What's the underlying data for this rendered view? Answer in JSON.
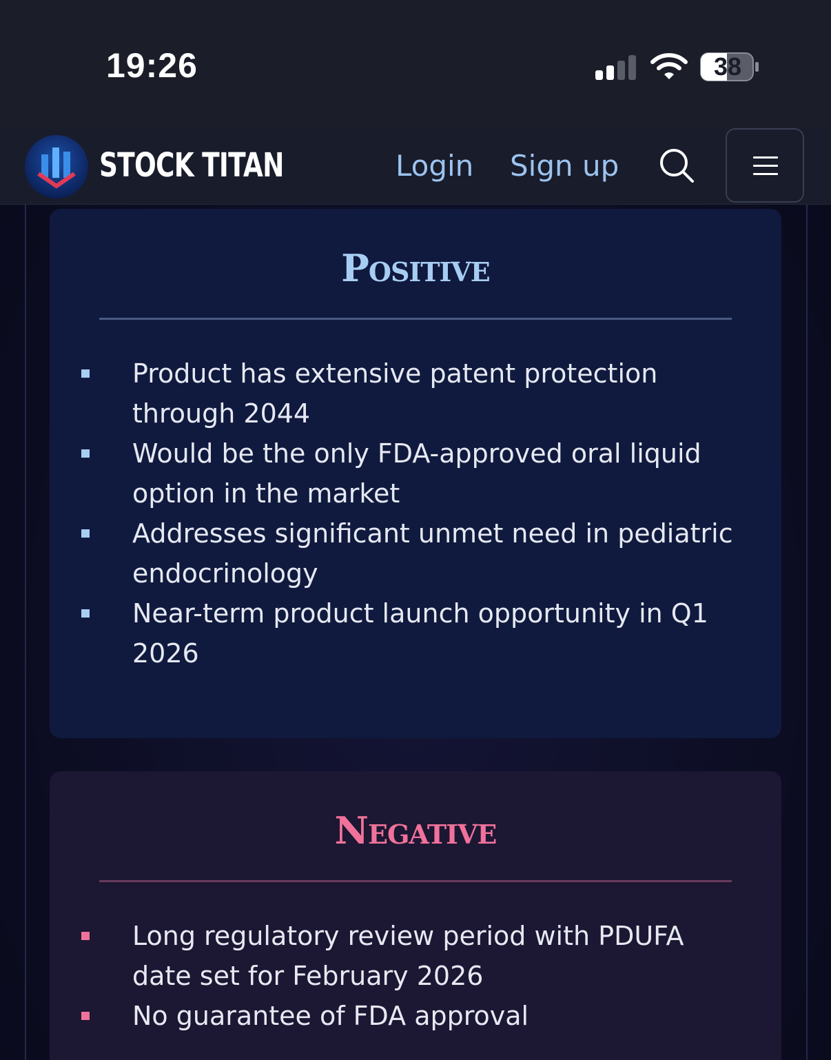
{
  "status_bar": {
    "time": "19:26",
    "battery": "38"
  },
  "nav": {
    "brand": "STOCK TITAN",
    "login": "Login",
    "signup": "Sign up"
  },
  "positive": {
    "title": "Positive",
    "items": [
      "Product has extensive patent protection through 2044",
      "Would be the only FDA-approved oral liquid option in the market",
      "Addresses significant unmet need in pediatric endocrinology",
      "Near-term product launch opportunity in Q1 2026"
    ]
  },
  "negative": {
    "title": "Negative",
    "items": [
      "Long regulatory review period with PDUFA date set for February 2026",
      "No guarantee of FDA approval"
    ]
  },
  "colors": {
    "positive_accent": "#a8cdf3",
    "negative_accent": "#f0729a",
    "link": "#9cc3ef"
  },
  "icons": [
    "signal-icon",
    "wifi-icon",
    "battery-icon",
    "logo-icon",
    "search-icon",
    "menu-icon"
  ]
}
